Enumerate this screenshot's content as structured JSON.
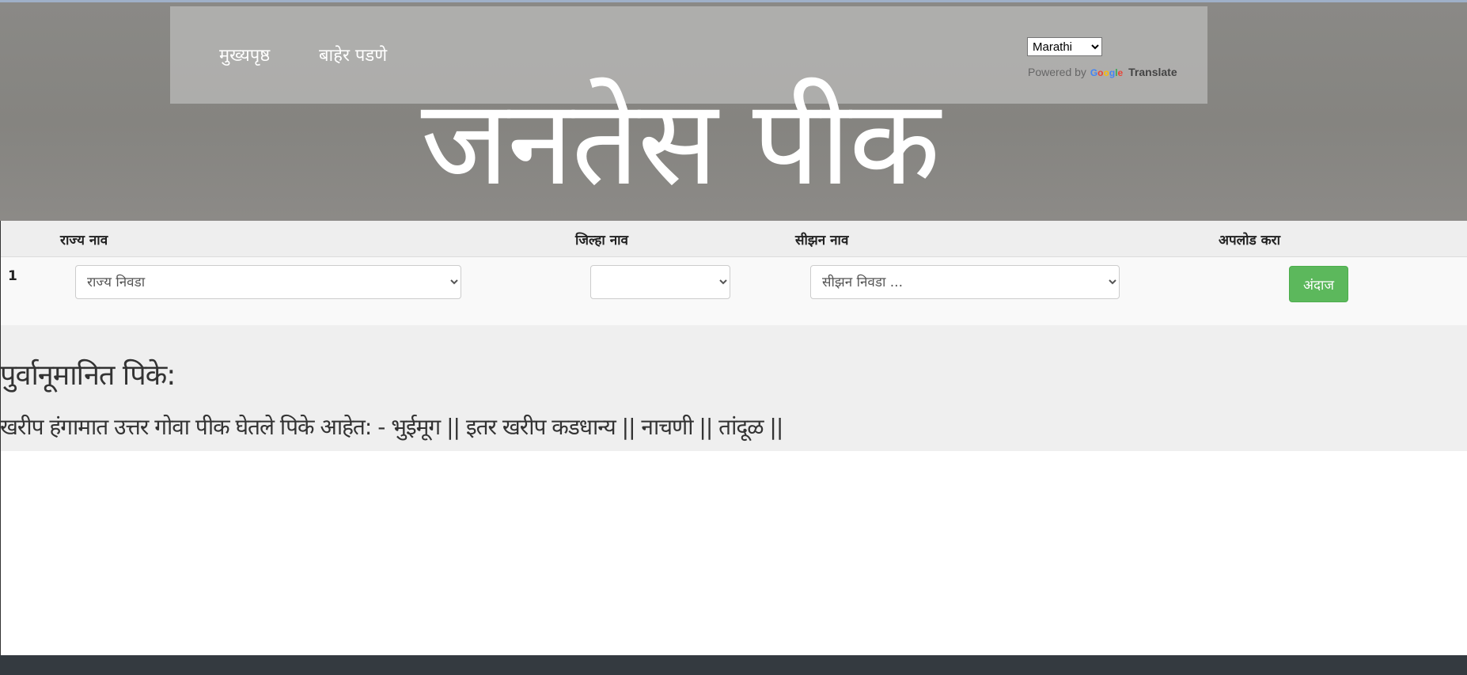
{
  "navbar": {
    "home_label": "मुख्यपृष्ठ",
    "logout_label": "बाहेर पडणे"
  },
  "translate": {
    "selected_language": "Marathi",
    "powered_by": "Powered by",
    "google_letters": [
      "G",
      "o",
      "o",
      "g",
      "l",
      "e"
    ],
    "translate_label": "Translate"
  },
  "hero": {
    "title": "जनतेस पीक"
  },
  "table": {
    "headers": {
      "state": "राज्य नाव",
      "district": "जिल्हा नाव",
      "season": "सीझन नाव",
      "upload": "अपलोड करा"
    },
    "row": {
      "number": "1",
      "state_select": "राज्य निवडा",
      "district_select": "",
      "season_select": "सीझन निवडा ...",
      "predict_button": "अंदाज"
    }
  },
  "results": {
    "heading": "पुर्वानूमानित पिके:",
    "text": "खरीप हंगामात उत्तर गोवा पीक घेतले पिके आहेत: - भुईमूग || इतर खरीप कडधान्य || नाचणी || तांदूळ ||"
  },
  "colors": {
    "hero_bg": "#868581",
    "button_green": "#5cb85c",
    "footer_bg": "#343a40"
  }
}
